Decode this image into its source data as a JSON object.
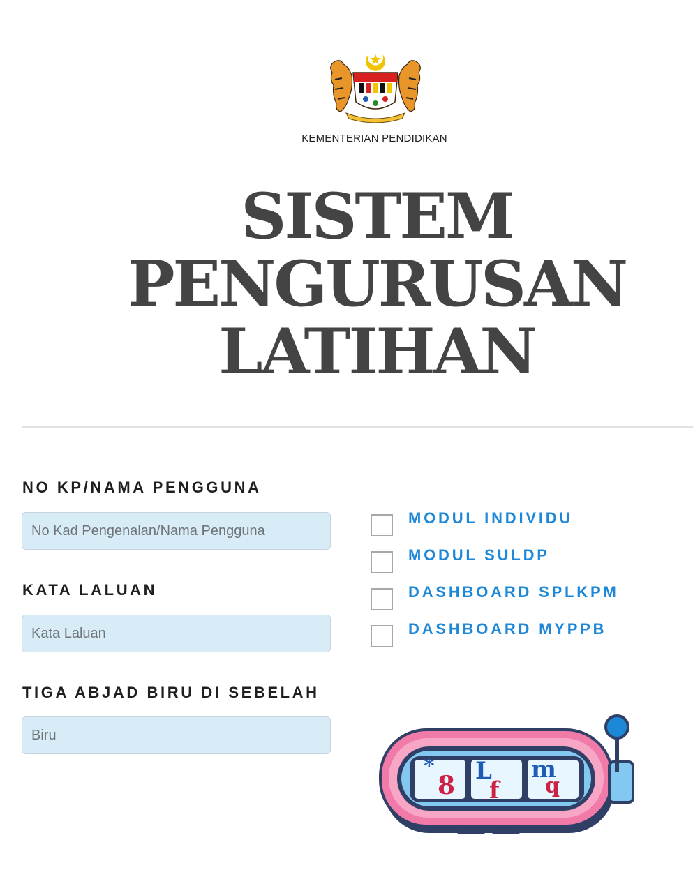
{
  "header": {
    "logo_icon": "malaysia-coat-of-arms",
    "ministry": "KEMENTERIAN PENDIDIKAN",
    "title_lines": [
      "SISTEM",
      "PENGURUSAN",
      "LATIHAN"
    ]
  },
  "form": {
    "username": {
      "label": "NO KP/NAMA PENGGUNA",
      "placeholder": "No Kad Pengenalan/Nama Pengguna",
      "value": ""
    },
    "password": {
      "label": "KATA LALUAN",
      "placeholder": "Kata Laluan",
      "value": ""
    },
    "captcha": {
      "label": "TIGA ABJAD BIRU DI SEBELAH",
      "placeholder": "Biru",
      "value": ""
    }
  },
  "modules": [
    {
      "label": "MODUL INDIVIDU",
      "checked": false
    },
    {
      "label": "MODUL SULDP",
      "checked": false
    },
    {
      "label": "DASHBOARD SPLKPM",
      "checked": false
    },
    {
      "label": "DASHBOARD MYPPB",
      "checked": false
    }
  ],
  "captcha_image": {
    "icon": "slot-machine-captcha",
    "reels": [
      {
        "top": "*",
        "bottom": "8"
      },
      {
        "top": "L",
        "bottom": "f"
      },
      {
        "top": "m",
        "bottom": "q"
      }
    ]
  },
  "colors": {
    "title": "#444444",
    "module_label": "#1e88d8",
    "input_bg": "#d8ecf8",
    "captcha_body": "#f07aa8",
    "captcha_glyph_blue": "#1e5bb5",
    "captcha_glyph_red": "#cc2244"
  }
}
